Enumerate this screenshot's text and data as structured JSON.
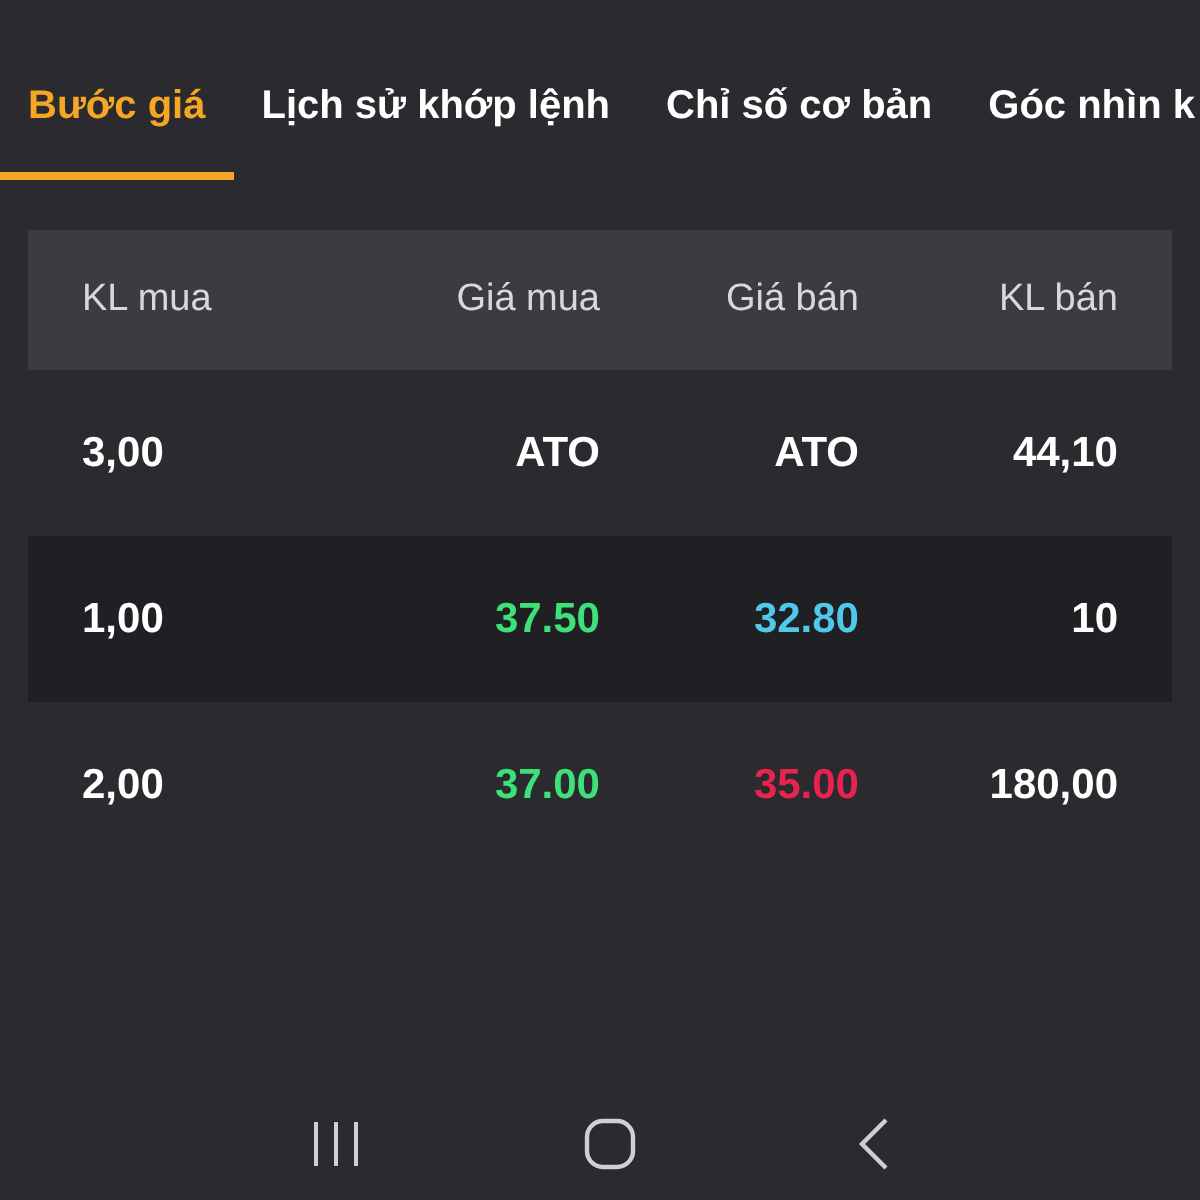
{
  "tabs": [
    {
      "label": "Bước giá",
      "selected": true
    },
    {
      "label": "Lịch sử khớp lệnh",
      "selected": false
    },
    {
      "label": "Chỉ số cơ bản",
      "selected": false
    },
    {
      "label": "Góc nhìn k",
      "selected": false
    }
  ],
  "table": {
    "columns": [
      "KL mua",
      "Giá mua",
      "Giá bán",
      "KL bán"
    ],
    "rows": [
      {
        "cells": [
          {
            "text": "3,00",
            "color": "#ffffff"
          },
          {
            "text": "ATO",
            "color": "#ffffff"
          },
          {
            "text": "ATO",
            "color": "#ffffff"
          },
          {
            "text": "44,10",
            "color": "#ffffff"
          }
        ]
      },
      {
        "cells": [
          {
            "text": "1,00",
            "color": "#ffffff"
          },
          {
            "text": "37.50",
            "color": "#3ee07a"
          },
          {
            "text": "32.80",
            "color": "#4fc9ea"
          },
          {
            "text": "10",
            "color": "#ffffff"
          }
        ]
      },
      {
        "cells": [
          {
            "text": "2,00",
            "color": "#ffffff"
          },
          {
            "text": "37.00",
            "color": "#3ee07a"
          },
          {
            "text": "35.00",
            "color": "#e8234f"
          },
          {
            "text": "180,00",
            "color": "#ffffff"
          }
        ]
      }
    ]
  }
}
